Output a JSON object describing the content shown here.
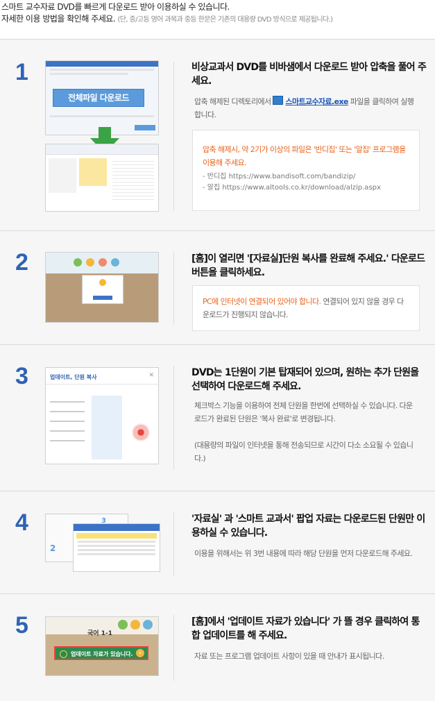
{
  "intro": {
    "line1": "스마트 교수자료 DVD를 빠르게 다운로드 받아 이용하실 수 있습니다.",
    "line2": "자세한 이용 방법을 확인해 주세요.",
    "line2_note": "(단, 중/고등 영어 과목과 중등 한문은 기존의 대용량 DVD 방식으로 제공됩니다.)"
  },
  "steps": [
    {
      "number": "1",
      "thumb_button": "전체파일 다운로드",
      "title": "비상교과서 DVD를 비바샘에서 다운로드 받아 압축을 풀어 주세요.",
      "desc_pre": "압축 해제된 디렉토리에서",
      "desc_link": "스마트교수자료.exe",
      "desc_post": "파일을 클릭하여 실행합니다.",
      "box_highlight": "압축 해제시, 약 2기가 이상의 파일은 '반디집' 또는 '알집' 프로그램을 이용해 주세요.",
      "box_url1": "- 반디집 https://www.bandisoft.com/bandizip/",
      "box_url2": "- 알집 https://www.altools.co.kr/download/alzip.aspx"
    },
    {
      "number": "2",
      "title": "[홈]이 열리면 '[자료실]단원 복사를 완료해 주세요.' 다운로드 버튼을 클릭하세요.",
      "box_highlight": "PC에 인터넷이 연결되어 있어야 합니다.",
      "box_text": "연결되어 있지 않을 경우 다운로드가 진행되지 않습니다."
    },
    {
      "number": "3",
      "thumb_title": "업데이트, 단원 복사",
      "title": "DVD는 1단원이 기본 탑재되어 있으며, 원하는 추가 단원을 선택하여 다운로드해 주세요.",
      "desc": "체크박스 기능을 이용하여 전체 단원을 한번에 선택하실 수 있습니다. 다운로드가 완료된 단원은 '복사 완료'로 변경됩니다.",
      "desc2": "(대용량의 파일이 인터넷을 통해 전송되므로 시간이 다소 소요될 수 있습니다.)"
    },
    {
      "number": "4",
      "title": "'자료실' 과 '스마트 교과서' 팝업 자료는 다운로드된 단원만 이용하실 수 있습니다.",
      "desc": "이용을 위해서는 위 3번 내용에 따라 해당 단원을 먼저 다운로드해 주세요."
    },
    {
      "number": "5",
      "thumb_subject": "국어 1-1",
      "thumb_banner": "업데이트 자료가 있습니다.",
      "title": "[홈]에서 '업데이트 자료가 있습니다' 가 뜰 경우 클릭하여 통합 업데이트를 해 주세요.",
      "desc": "자료 또는 프로그램 업데이트 사항이 있을 때 안내가 표시됩니다."
    }
  ]
}
